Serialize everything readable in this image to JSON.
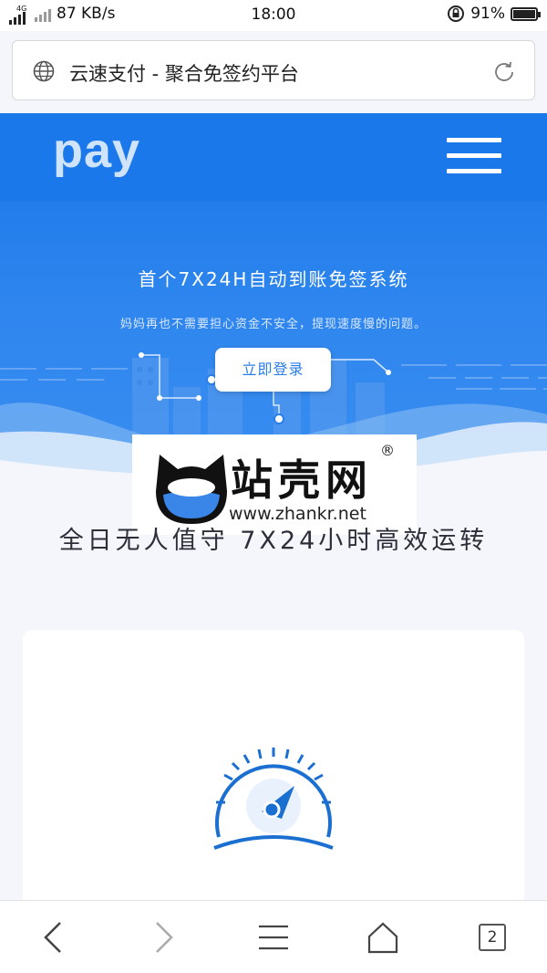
{
  "status_bar": {
    "network_type": "4G",
    "speed": "87 KB/s",
    "time": "18:00",
    "battery": "91%",
    "battery_level": 0.91
  },
  "browser": {
    "page_title": "云速支付 - 聚合免签约平台",
    "open_tabs": "2"
  },
  "hero": {
    "logo": "pay",
    "title": "首个7X24H自动到账免签系统",
    "subtitle": "妈妈再也不需要担心资金不安全，提现速度慢的问题。",
    "login_button": "立即登录"
  },
  "watermark": {
    "name": "站壳网",
    "url": "www.zhankr.net",
    "registered": "®"
  },
  "section": {
    "title": "全日无人值守 7X24小时高效运转"
  },
  "colors": {
    "brand_blue": "#1b78ea",
    "page_bg": "#f4f6fb",
    "icon_blue": "#1a6fd0"
  }
}
